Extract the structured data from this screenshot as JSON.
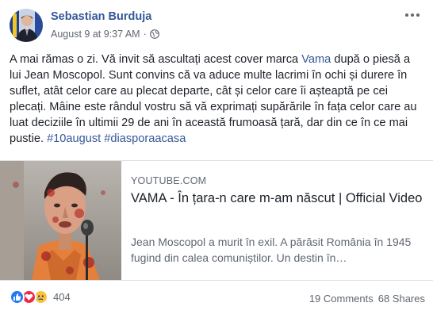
{
  "post": {
    "author": "Sebastian Burduja",
    "timestamp": "August 9 at 9:37 AM",
    "separator": "·",
    "privacy_icon": "globe-icon",
    "options_icon": "more-options-icon",
    "body": {
      "t1": "A mai rămas o zi. Vă invit să ascultați acest cover marca ",
      "link_vama": "Vama",
      "t2": " după o piesă a lui Jean Moscopol. Sunt convins că va aduce multe lacrimi în ochi și durere în suflet, atât celor care au plecat departe, cât și celor care îi așteaptă pe cei plecați. Mâine este rândul vostru să vă exprimați supărările în fața celor care au luat deciziile în ultimii 29 de ani în această frumoasă țară, dar din ce în ce mai pustie. ",
      "hashtag1": "#10august",
      "space": " ",
      "hashtag2": "#diasporaacasa"
    }
  },
  "link_card": {
    "domain": "YOUTUBE.COM",
    "title": "VAMA - În țara-n care m-am născut | Official Video",
    "description": "Jean Moscopol a murit în exil. A părăsit România în 1945 fugind din calea comuniștilor. Un destin în…"
  },
  "footer": {
    "reaction_icons": [
      "like-icon",
      "love-icon",
      "sad-icon"
    ],
    "reaction_count": "404",
    "comments": "19 Comments",
    "shares": "68 Shares"
  },
  "colors": {
    "link_blue": "#365899",
    "like_blue": "#2078f4",
    "love_red": "#f0284a",
    "sad_yellow": "#f7c33f"
  }
}
